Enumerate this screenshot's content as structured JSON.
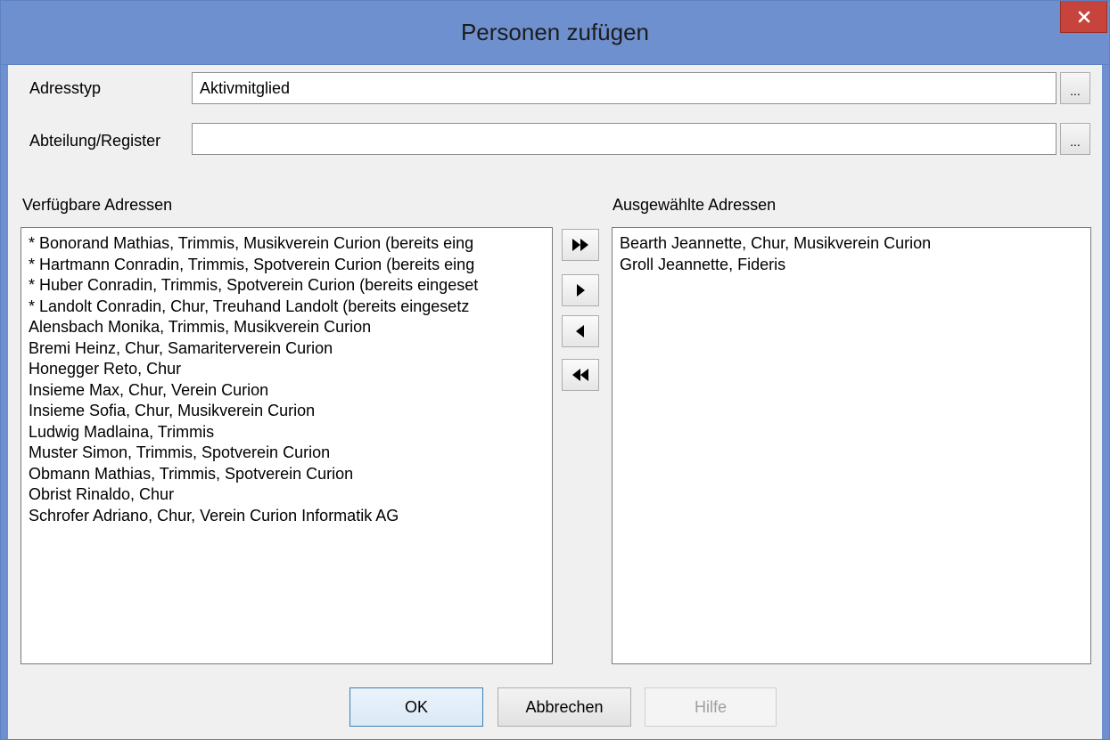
{
  "window": {
    "title": "Personen zufügen",
    "close_glyph": "×"
  },
  "fields": {
    "adresstyp_label": "Adresstyp",
    "adresstyp_value": "Aktivmitglied",
    "abteilung_label": "Abteilung/Register",
    "abteilung_value": "",
    "browse_label": "..."
  },
  "available": {
    "header": "Verfügbare Adressen",
    "items": [
      "* Bonorand Mathias, Trimmis, Musikverein Curion (bereits eing",
      "* Hartmann Conradin, Trimmis, Spotverein Curion (bereits eing",
      "* Huber Conradin, Trimmis, Spotverein Curion (bereits eingeset",
      "* Landolt Conradin, Chur, Treuhand Landolt (bereits eingesetz",
      "Alensbach Monika, Trimmis, Musikverein Curion",
      "Bremi Heinz, Chur, Samariterverein Curion",
      "Honegger Reto, Chur",
      "Insieme Max, Chur, Verein Curion",
      "Insieme Sofia, Chur, Musikverein Curion",
      "Ludwig Madlaina, Trimmis",
      "Muster Simon, Trimmis, Spotverein Curion",
      "Obmann Mathias, Trimmis, Spotverein Curion",
      "Obrist Rinaldo, Chur",
      "Schrofer Adriano, Chur, Verein Curion Informatik AG"
    ]
  },
  "selected": {
    "header": "Ausgewählte Adressen",
    "items": [
      "Bearth Jeannette, Chur, Musikverein Curion",
      "Groll Jeannette, Fideris"
    ]
  },
  "transfer_buttons": [
    {
      "icon": "double-right-arrow-icon"
    },
    {
      "icon": "right-arrow-icon"
    },
    {
      "icon": "left-arrow-icon"
    },
    {
      "icon": "double-left-arrow-icon"
    }
  ],
  "buttons": {
    "ok": "OK",
    "cancel": "Abbrechen",
    "help": "Hilfe"
  },
  "colors": {
    "titlebar": "#6e90cf",
    "close": "#c7443d",
    "dialog_bg": "#f0f0f0"
  }
}
